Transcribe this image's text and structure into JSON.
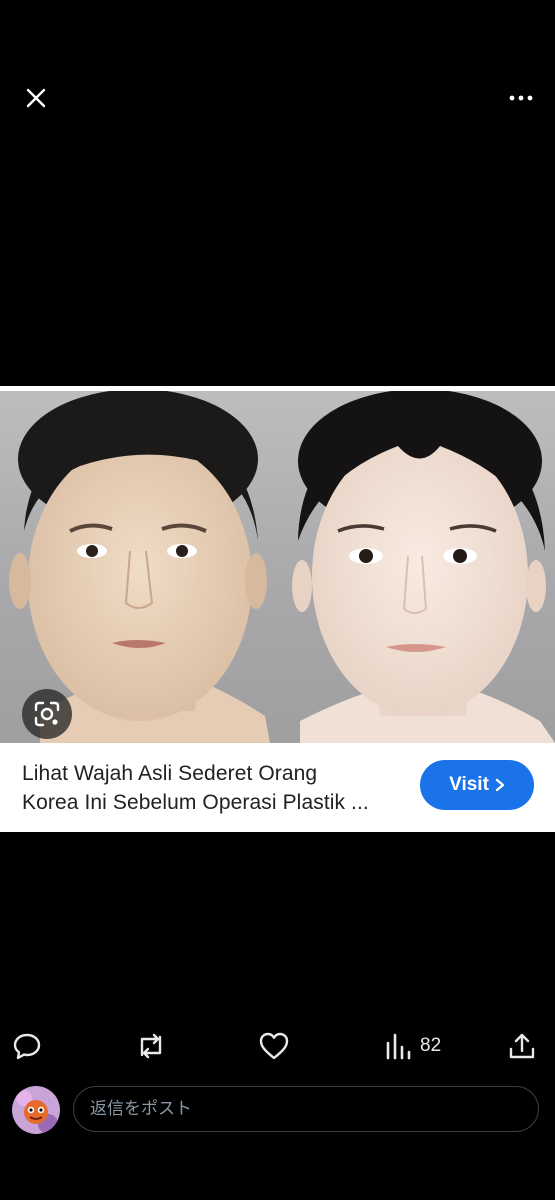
{
  "topbar": {
    "close_icon": "close-icon",
    "more_icon": "more-horizontal-icon"
  },
  "media": {
    "lens_icon": "google-lens-icon",
    "caption": {
      "line1": "Lihat Wajah Asli Sederet Orang",
      "line2": "Korea Ini Sebelum Operasi Plastik ..."
    },
    "visit_label": "Visit"
  },
  "actions": {
    "reply_icon": "reply-icon",
    "repost_icon": "repost-icon",
    "like_icon": "heart-icon",
    "views_icon": "views-icon",
    "views_count": "82",
    "share_icon": "share-icon"
  },
  "reply": {
    "placeholder": "返信をポスト"
  },
  "colors": {
    "accent": "#1a73e8",
    "background": "#000000",
    "icon": "#e7e9ea"
  }
}
